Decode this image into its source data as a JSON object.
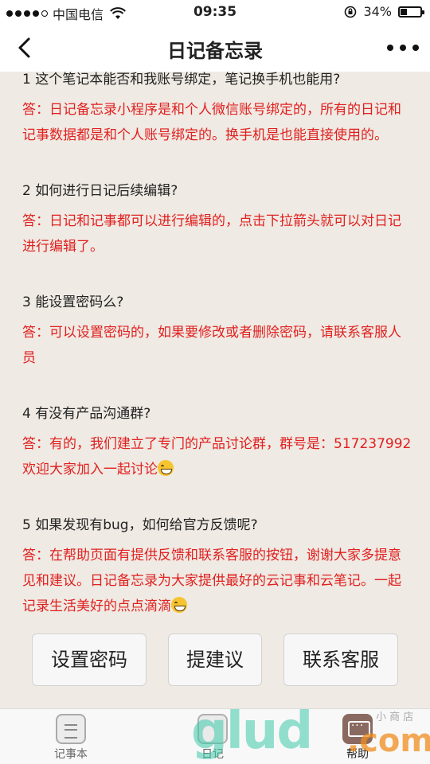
{
  "status_bar": {
    "carrier": "中国电信",
    "time": "09:35",
    "battery": "34%"
  },
  "nav": {
    "title": "日记备忘录"
  },
  "faq": [
    {
      "question": "1 这个笔记本能否和我账号绑定，笔记换手机也能用?",
      "answer": "答：日记备忘录小程序是和个人微信账号绑定的，所有的日记和记事数据都是和个人账号绑定的。换手机是也能直接使用的。"
    },
    {
      "question": "2 如何进行日记后续编辑?",
      "answer": "答：日记和记事都可以进行编辑的，点击下拉箭头就可以对日记进行编辑了。"
    },
    {
      "question": "3 能设置密码么?",
      "answer": "答：可以设置密码的，如果要修改或者删除密码，请联系客服人员"
    },
    {
      "question": "4 有没有产品沟通群?",
      "answer": "答：有的，我们建立了专门的产品讨论群，群号是：517237992 欢迎大家加入一起讨论"
    },
    {
      "question": "5 如果发现有bug，如何给官方反馈呢?",
      "answer": "答：在帮助页面有提供反馈和联系客服的按钮，谢谢大家多提意见和建议。日记备忘录为大家提供最好的云记事和云笔记。一起记录生活美好的点点滴滴"
    }
  ],
  "actions": {
    "set_password": "设置密码",
    "suggest": "提建议",
    "contact": "联系客服"
  },
  "tabs": [
    {
      "label": "记事本",
      "icon": "notebook-icon"
    },
    {
      "label": "日记",
      "icon": "diary-icon"
    },
    {
      "label": "帮助",
      "icon": "help-chat-icon"
    }
  ],
  "watermark": {
    "brand": "glud",
    "suffix": ".com",
    "small": "小 商 店"
  }
}
